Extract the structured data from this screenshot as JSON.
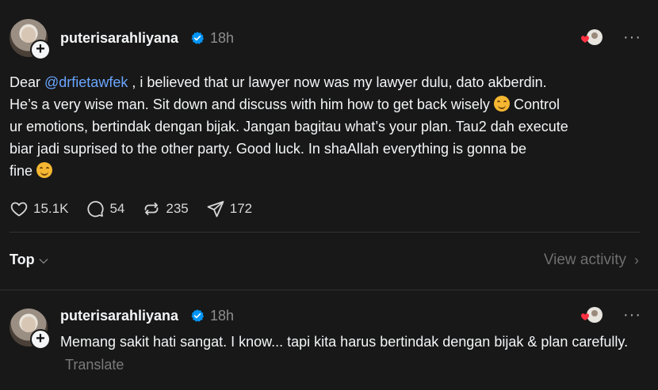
{
  "post": {
    "username": "puterisarahliyana",
    "time": "18h",
    "more_label": "···",
    "body_prefix": "Dear ",
    "mention": "@drfietawfek",
    "body_line_1_rest": " , i believed that ur lawyer now was my lawyer dulu, dato akberdin.",
    "body_line_2": "He’s a very wise man. Sit down and discuss with him how to get back wisely",
    "body_line_2_tail": " Control",
    "body_line_3": "ur emotions, bertindak dengan bijak. Jangan bagitau what’s your plan. Tau2 dah execute",
    "body_line_4": "biar jadi suprised to the other party. Good luck. In shaAllah everything is gonna be",
    "body_line_5": "fine",
    "stats": {
      "likes": "15.1K",
      "comments": "54",
      "reposts": "235",
      "shares": "172"
    }
  },
  "replies_header": {
    "sort_label": "Top",
    "view_activity_label": "View activity"
  },
  "reply": {
    "username": "puterisarahliyana",
    "time": "18h",
    "more_label": "···",
    "text": "Memang sakit hati sangat. I know... tapi kita harus bertindak dengan bijak & plan carefully.",
    "translate_label": "Translate"
  },
  "colors": {
    "background": "#181818",
    "mention": "#6aa6ff",
    "verified": "#0095f6",
    "muted": "#8e8e8e"
  },
  "icons": [
    "plus-icon",
    "verified-badge-icon",
    "heart-icon",
    "comment-icon",
    "repost-icon",
    "share-icon",
    "chevron-down-icon",
    "chevron-right-icon",
    "more-icon",
    "smile-emoji"
  ]
}
